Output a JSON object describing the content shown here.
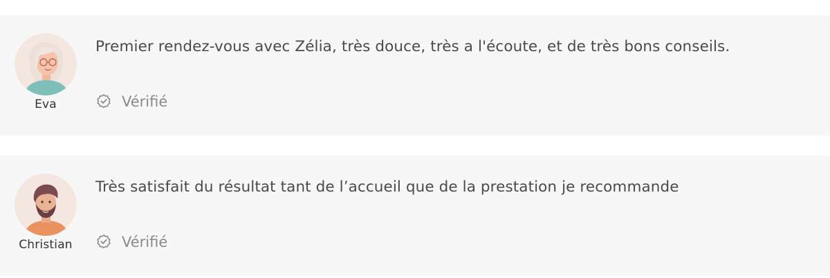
{
  "reviews": [
    {
      "author": "Eva",
      "avatar_icon": "woman-avatar-icon",
      "comment": "Premier rendez-vous avec Zélia, très douce, très a l'écoute, et de très bons conseils.",
      "badge_icon": "verified-check-icon",
      "badge": "Vérifié"
    },
    {
      "author": "Christian",
      "avatar_icon": "bearded-man-avatar-icon",
      "comment": "Très satisfait du résultat tant de l’accueil que de la prestation je recommande",
      "badge_icon": "verified-check-icon",
      "badge": "Vérifié"
    }
  ],
  "colors": {
    "card_background": "#f7f7f7",
    "comment_text": "#4a4a4a",
    "badge_text": "#8a8a8a",
    "avatar_background": "#f3e7df"
  }
}
